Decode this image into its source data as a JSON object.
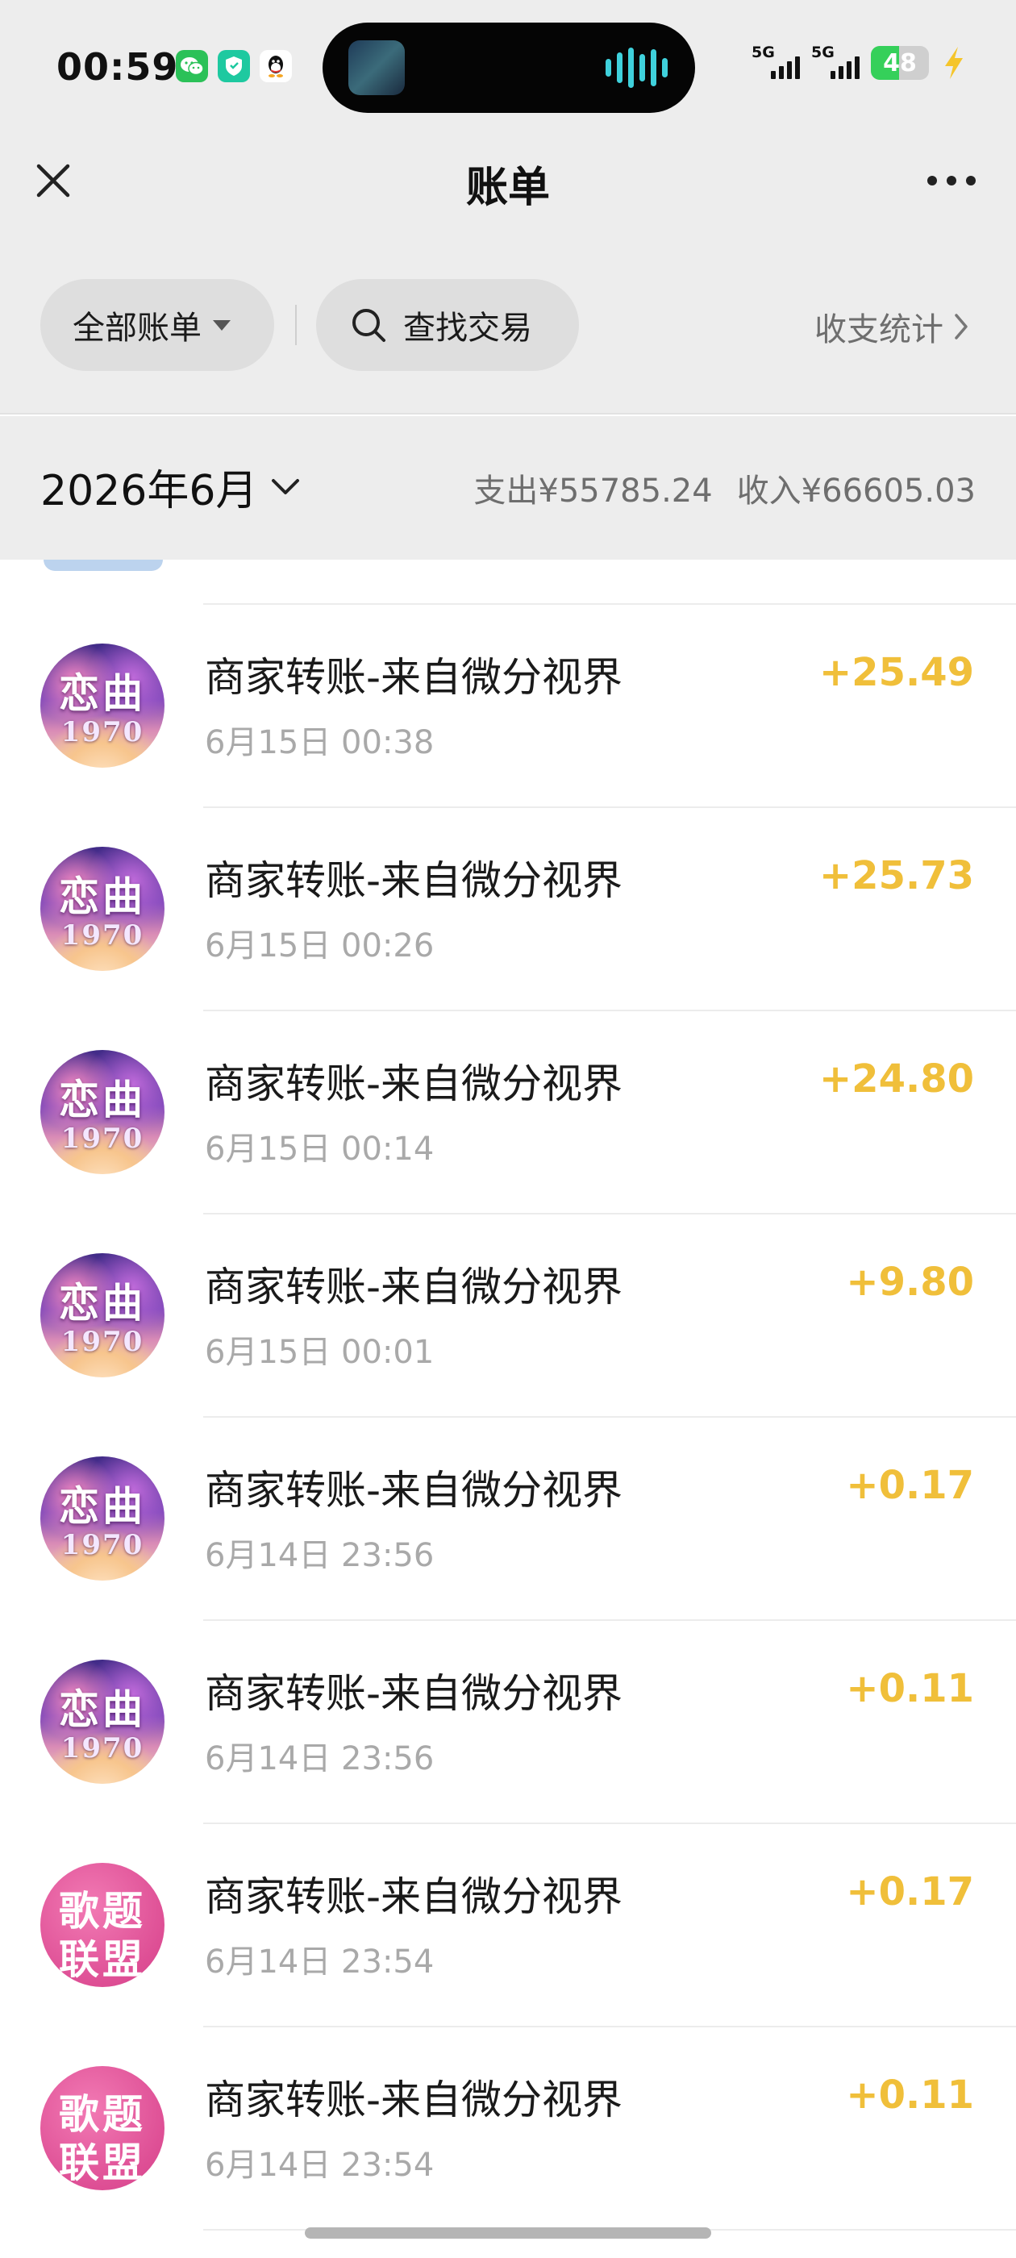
{
  "status_bar": {
    "time": "00:59",
    "apps": [
      "wechat-icon",
      "shield-app-icon",
      "qq-penguin-icon"
    ],
    "signal_1": "5G",
    "signal_2": "5G",
    "battery": "48",
    "battery_level": 0.48,
    "charging": true,
    "colors": {
      "battery_fill": "#35d05a",
      "bolt": "#f5c52b",
      "island_wave": "#3fd1dc"
    }
  },
  "header": {
    "title": "账单",
    "close_icon": "close-icon",
    "more_icon": "more-dots-icon"
  },
  "filters": {
    "all_bills": "全部账单",
    "search": "查找交易",
    "stats": "收支统计"
  },
  "month": {
    "label": "2026年6月",
    "expense": "支出¥55785.24",
    "income": "收入¥66605.03"
  },
  "colors": {
    "income_amount": "#f0bf3a",
    "background_gray": "#ededed",
    "secondary_text": "#a9a9a9"
  },
  "transactions": [
    {
      "avatar": "恋曲1970",
      "avatar_top": "恋曲",
      "avatar_bottom": "1970",
      "title": "商家转账-来自微分视界",
      "time": "6月15日 00:38",
      "amount": "+25.49"
    },
    {
      "avatar": "恋曲1970",
      "avatar_top": "恋曲",
      "avatar_bottom": "1970",
      "title": "商家转账-来自微分视界",
      "time": "6月15日 00:26",
      "amount": "+25.73"
    },
    {
      "avatar": "恋曲1970",
      "avatar_top": "恋曲",
      "avatar_bottom": "1970",
      "title": "商家转账-来自微分视界",
      "time": "6月15日 00:14",
      "amount": "+24.80"
    },
    {
      "avatar": "恋曲1970",
      "avatar_top": "恋曲",
      "avatar_bottom": "1970",
      "title": "商家转账-来自微分视界",
      "time": "6月15日 00:01",
      "amount": "+9.80"
    },
    {
      "avatar": "恋曲1970",
      "avatar_top": "恋曲",
      "avatar_bottom": "1970",
      "title": "商家转账-来自微分视界",
      "time": "6月14日 23:56",
      "amount": "+0.17"
    },
    {
      "avatar": "恋曲1970",
      "avatar_top": "恋曲",
      "avatar_bottom": "1970",
      "title": "商家转账-来自微分视界",
      "time": "6月14日 23:56",
      "amount": "+0.11"
    },
    {
      "avatar": "歌题联盟",
      "avatar_top": "歌题",
      "avatar_bottom": "联盟",
      "title": "商家转账-来自微分视界",
      "time": "6月14日 23:54",
      "amount": "+0.17"
    },
    {
      "avatar": "歌题联盟",
      "avatar_top": "歌题",
      "avatar_bottom": "联盟",
      "title": "商家转账-来自微分视界",
      "time": "6月14日 23:54",
      "amount": "+0.11"
    }
  ]
}
